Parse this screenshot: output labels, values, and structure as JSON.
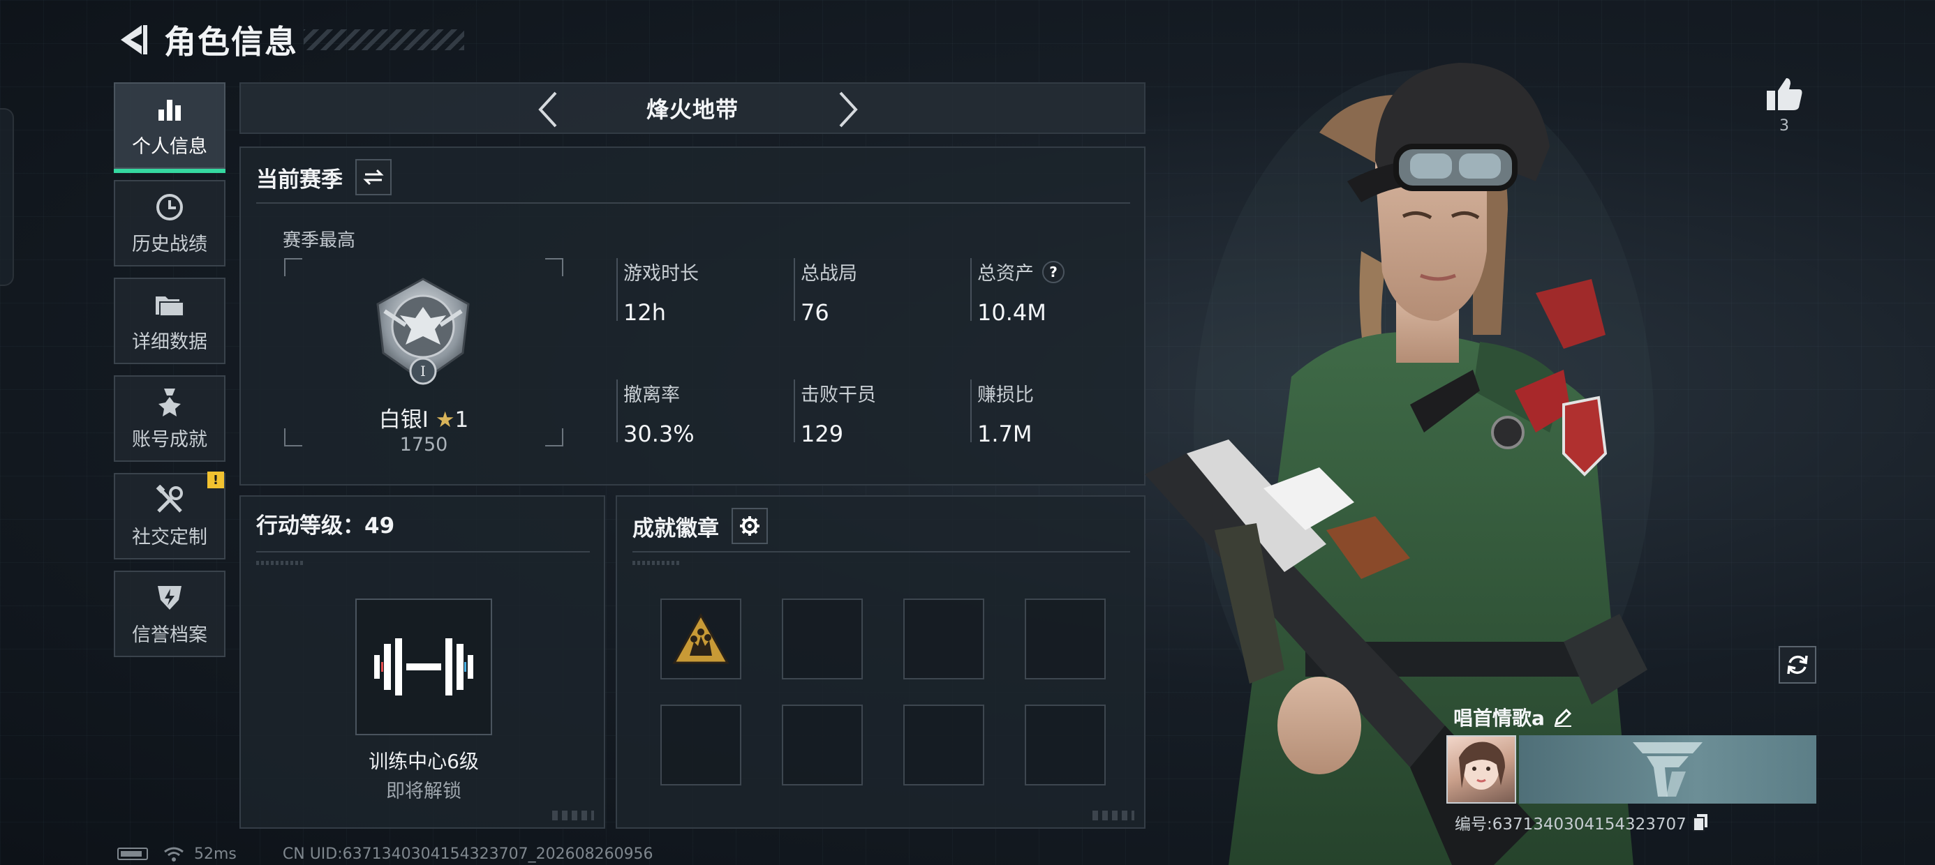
{
  "header": {
    "title": "角色信息"
  },
  "nav": {
    "items": [
      {
        "label": "个人信息",
        "icon": "bar-chart-icon",
        "active": true
      },
      {
        "label": "历史战绩",
        "icon": "history-clock-icon"
      },
      {
        "label": "详细数据",
        "icon": "folder-icon"
      },
      {
        "label": "账号成就",
        "icon": "medal-icon"
      },
      {
        "label": "社交定制",
        "icon": "tools-icon",
        "badge": "!"
      },
      {
        "label": "信誉档案",
        "icon": "shield-bolt-icon"
      }
    ]
  },
  "mode": {
    "title": "烽火地带"
  },
  "season": {
    "title": "当前赛季",
    "subtitle": "赛季最高",
    "rank": {
      "name": "白银I",
      "stars": "1",
      "score": "1750",
      "roman": "I"
    },
    "stats": [
      {
        "label": "游戏时长",
        "value": "12h"
      },
      {
        "label": "总战局",
        "value": "76"
      },
      {
        "label": "总资产",
        "value": "10.4M",
        "help": "?"
      },
      {
        "label": "撤离率",
        "value": "30.3%"
      },
      {
        "label": "击败干员",
        "value": "129"
      },
      {
        "label": "赚损比",
        "value": "1.7M"
      }
    ]
  },
  "level": {
    "title": "行动等级：49",
    "unlock_text": "训练中心6级",
    "unlock_status": "即将解锁"
  },
  "achievements": {
    "title": "成就徽章",
    "slots": 8,
    "filled": 1
  },
  "social": {
    "likes": "3"
  },
  "player": {
    "name": "唱首情歌a",
    "id_text": "编号:6371340304154323707"
  },
  "status_bar": {
    "ping": "52ms",
    "uid": "CN UID:6371340304154323707_202608260956"
  },
  "colors": {
    "accent": "#35d8a0",
    "badge": "#f2c230",
    "star": "#d9b45a"
  }
}
